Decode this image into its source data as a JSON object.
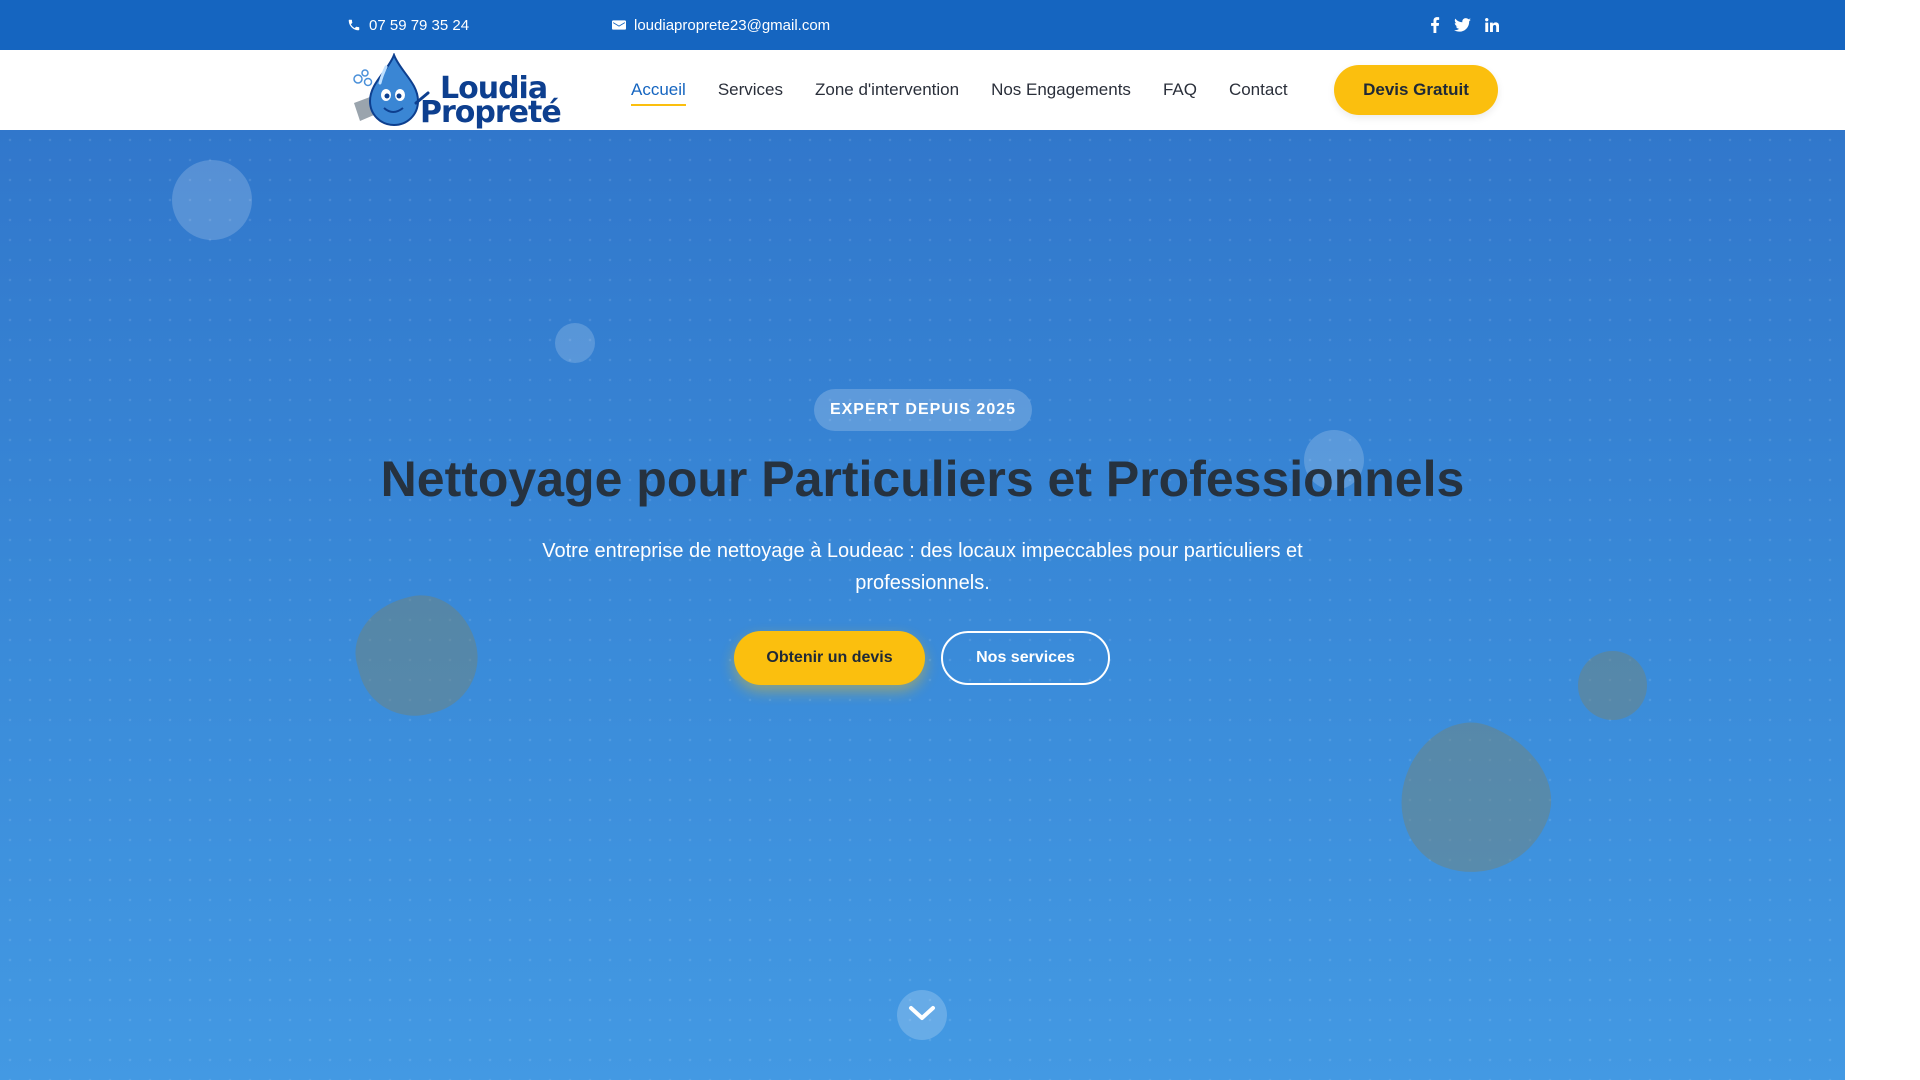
{
  "topbar": {
    "phone": "07 59 79 35 24",
    "email": "loudiaproprete23@gmail.com",
    "socials": [
      "facebook-icon",
      "twitter-icon",
      "linkedin-icon"
    ]
  },
  "logo": {
    "line1": "Loudia",
    "line2": "Propreté"
  },
  "nav": {
    "items": [
      {
        "label": "Accueil",
        "active": true
      },
      {
        "label": "Services"
      },
      {
        "label": "Zone d'intervention"
      },
      {
        "label": "Nos Engagements"
      },
      {
        "label": "FAQ"
      },
      {
        "label": "Contact"
      }
    ],
    "cta": "Devis Gratuit"
  },
  "hero": {
    "badge": "EXPERT DEPUIS 2025",
    "title": "Nettoyage pour Particuliers et Professionnels",
    "subtitle": "Votre entreprise de nettoyage à Loudeac : des locaux impeccables pour particuliers et professionnels.",
    "primary_button": "Obtenir un devis",
    "secondary_button": "Nos services",
    "scroll_icon": "chevron-down-icon"
  },
  "colors": {
    "brand_blue": "#1565c0",
    "accent_yellow": "#fbbf0e",
    "hero_gradient_top": "#3177cb",
    "hero_gradient_bottom": "#4399e3"
  }
}
